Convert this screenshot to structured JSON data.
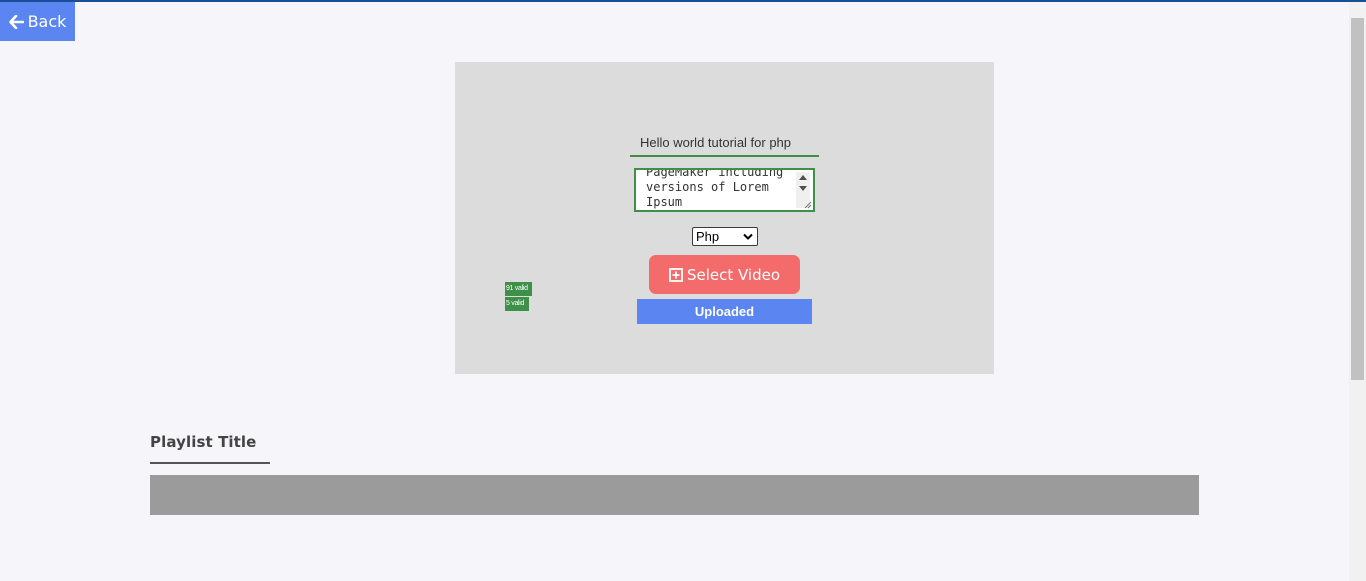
{
  "nav": {
    "back_label": "Back",
    "back_icon": "arrow-left-icon"
  },
  "upload": {
    "title_value": "Hello world tutorial for php",
    "description_value": "PageMaker including versions of Lorem Ipsum",
    "category_selected": "Php",
    "select_video_label": "Select Video",
    "select_video_icon": "plus-square-icon",
    "upload_status": "Uploaded",
    "validation": [
      "91 valid",
      "5 valid"
    ]
  },
  "playlist": {
    "title": "Playlist Title"
  },
  "colors": {
    "top_line": "#1a4e95",
    "primary_blue": "#5b85f0",
    "coral_button": "#f46b6b",
    "valid_green": "#3e8f48",
    "panel_gray": "#dcdcdc",
    "playlist_bar": "#9b9b9b",
    "background": "#f5f5fa"
  }
}
